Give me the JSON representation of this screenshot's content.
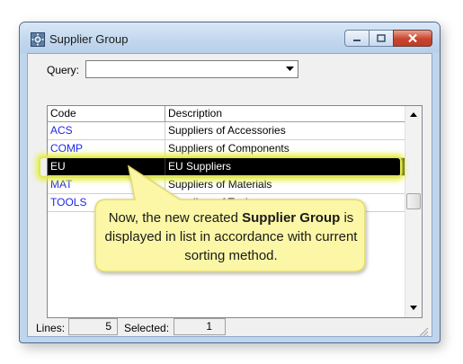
{
  "window": {
    "title": "Supplier Group"
  },
  "query": {
    "label": "Query:",
    "value": ""
  },
  "grid": {
    "columns": [
      "Code",
      "Description"
    ],
    "rows": [
      {
        "code": "ACS",
        "description": "Suppliers of Accessories"
      },
      {
        "code": "COMP",
        "description": "Suppliers of Components"
      },
      {
        "code": "EU",
        "description": "EU Suppliers"
      },
      {
        "code": "MAT",
        "description": "Suppliers of Materials"
      },
      {
        "code": "TOOLS",
        "description": "Suppliers of Tools"
      }
    ],
    "selected_index": 2
  },
  "statusbar": {
    "lines_label": "Lines:",
    "lines_value": "5",
    "selected_label": "Selected:",
    "selected_value": "1"
  },
  "callout": {
    "text_before": "Now, the new created ",
    "text_bold": "Supplier Group",
    "text_after": " is displayed in list in accordance with current sorting method."
  },
  "colors": {
    "code_text": "#1d27ea",
    "selection_bg": "#000000",
    "selection_glow": "#dfe94a",
    "callout_fill": "#fbf7a6",
    "close_button": "#c7452f"
  }
}
